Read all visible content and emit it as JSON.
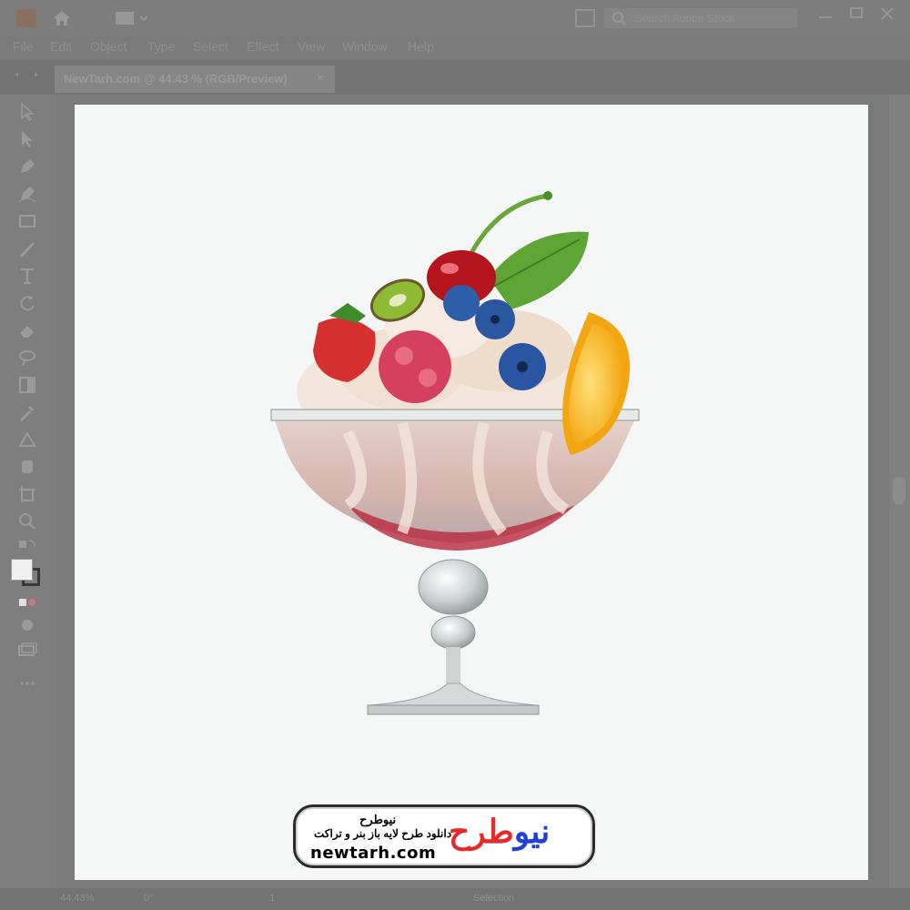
{
  "app": {
    "icon": "ai-logo-icon"
  },
  "menu": [
    "File",
    "Edit",
    "Object",
    "Type",
    "Select",
    "Effect",
    "View",
    "Window",
    "Help"
  ],
  "search": {
    "placeholder": "Search Adobe Stock"
  },
  "document_tab": {
    "title": "NewTarh.com @ 44.43 % (RGB/Preview)",
    "close": "×"
  },
  "toolbar": {
    "tools": [
      "selection-tool",
      "direct-selection-tool",
      "pen-tool",
      "curvature-tool",
      "rectangle-tool",
      "brush-tool",
      "type-tool",
      "rotate-tool",
      "eraser-tool",
      "lasso-tool",
      "gradient-tool",
      "eyedropper-tool",
      "blend-tool",
      "symbol-sprayer-tool",
      "artboard-tool",
      "zoom-tool",
      "swap-colors-tool",
      "fill-stroke-swatch",
      "draw-mode-tool",
      "screen-mode-tool",
      "edit-toolbar-tool"
    ]
  },
  "status": {
    "zoom": "44.43%",
    "angle": "0°",
    "artboard": "1",
    "mode": "Selection"
  },
  "watermark": {
    "logo_blue": "نیو",
    "logo_red": "طرح",
    "site_name_fa": "نیوطرح",
    "tagline_fa": "دانلود طرح لایه باز بنر و تراکت",
    "url": "newtarh.com"
  },
  "colors": {
    "accent_blue": "#1f3fd8",
    "accent_red": "#e52a2a",
    "artboard": "#f5f6f6",
    "chrome": "#7d7d7d"
  }
}
